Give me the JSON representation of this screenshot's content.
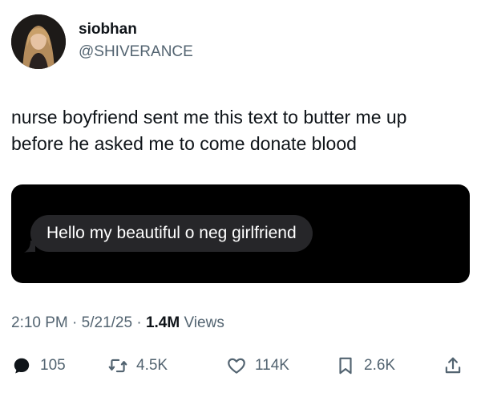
{
  "author": {
    "display_name": "siobhan",
    "handle": "@SHIVERANCE"
  },
  "tweet": {
    "text_line1": "nurse boyfriend sent me this text to butter me up",
    "text_line2": "before he asked me to come donate blood"
  },
  "media": {
    "message_text": "Hello my beautiful o neg girlfriend"
  },
  "meta": {
    "time": "2:10 PM",
    "sep1": " · ",
    "date": "5/21/25",
    "sep2": " · ",
    "views_count": "1.4M",
    "views_label": " Views"
  },
  "actions": {
    "replies": "105",
    "reposts": "4.5K",
    "likes": "114K",
    "bookmarks": "2.6K"
  },
  "icons": [
    "reply-icon",
    "repost-icon",
    "like-icon",
    "bookmark-icon",
    "share-icon"
  ]
}
